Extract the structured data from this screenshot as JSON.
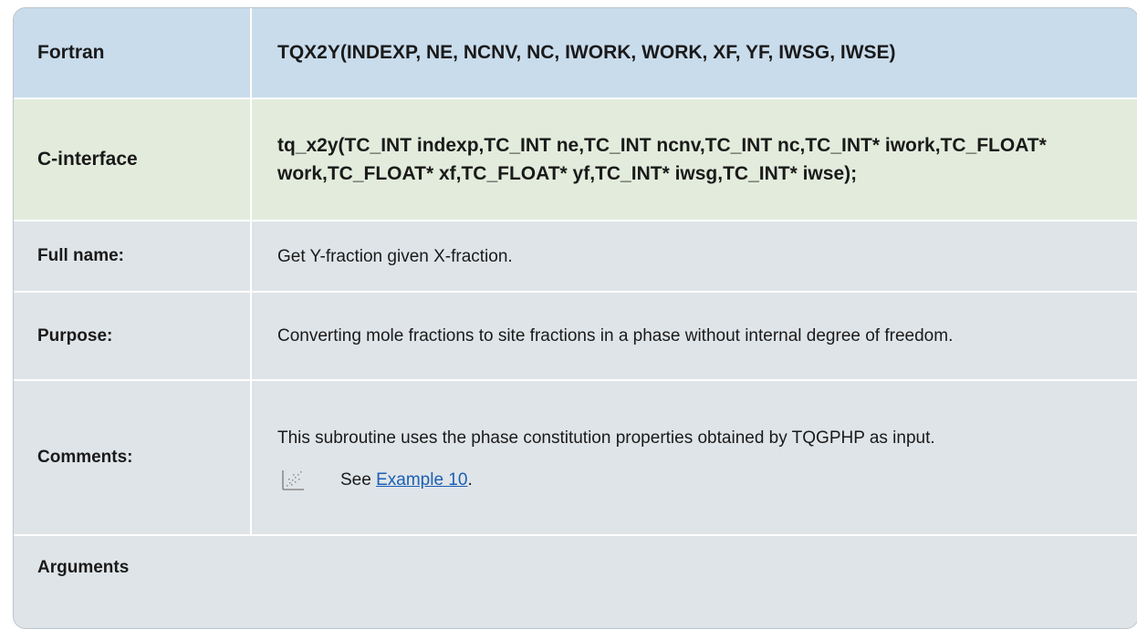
{
  "fortran": {
    "label": "Fortran",
    "signature": "TQX2Y(INDEXP, NE, NCNV, NC, IWORK, WORK, XF, YF, IWSG, IWSE)"
  },
  "c_interface": {
    "label": "C-interface",
    "signature": "tq_x2y(TC_INT indexp,TC_INT ne,TC_INT ncnv,TC_INT nc,TC_INT* iwork,TC_FLOAT* work,TC_FLOAT* xf,TC_FLOAT* yf,TC_INT* iwsg,TC_INT* iwse);"
  },
  "full_name": {
    "label": "Full name:",
    "value": "Get Y-fraction given X-fraction."
  },
  "purpose": {
    "label": "Purpose:",
    "value": "Converting mole fractions to site fractions in a phase without internal degree of freedom."
  },
  "comments": {
    "label": "Comments:",
    "value": "This subroutine uses the phase constitution properties obtained by TQGPHP as input.",
    "see_prefix": "See",
    "link_text": "Example 10",
    "see_suffix": ".",
    "icon": "example-chart-icon"
  },
  "arguments": {
    "label": "Arguments"
  }
}
